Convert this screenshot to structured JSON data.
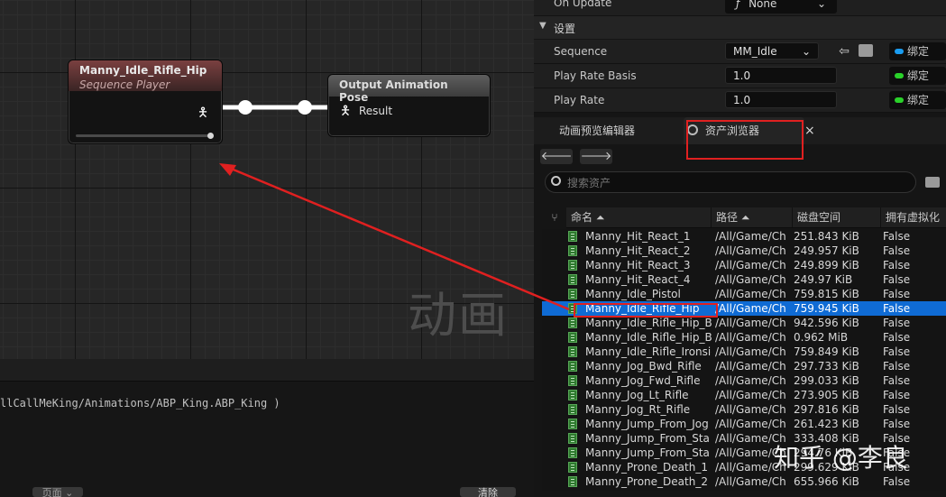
{
  "graph": {
    "node1": {
      "title": "Manny_Idle_Rifle_Hip",
      "subtitle": "Sequence Player"
    },
    "node2": {
      "title": "Output Animation Pose",
      "pin": "Result"
    },
    "watermark": "动画"
  },
  "log": {
    "path_text": "llCallMeKing/Animations/ABP_King.ABP_King )",
    "page_btn": "页面 ⌄",
    "clear_btn": "清除"
  },
  "details": {
    "on_update": {
      "label": "On Update",
      "value": "None",
      "fx": "ƒ"
    },
    "section": "设置",
    "rows": [
      {
        "label": "Sequence",
        "value": "MM_Idle",
        "bind": "绑定",
        "dot_color": "#1a9cf0"
      },
      {
        "label": "Play Rate Basis",
        "value": "1.0",
        "bind": "绑定",
        "dot_color": "#2ad22a"
      },
      {
        "label": "Play Rate",
        "value": "1.0",
        "bind": "绑定",
        "dot_color": "#2ad22a"
      }
    ]
  },
  "tabs": {
    "anim_preview": "动画预览编辑器",
    "asset_browser": "资产浏览器",
    "close": "×"
  },
  "asset_browser": {
    "search_placeholder": "搜索资产",
    "columns": [
      "命名 ⏶",
      "路径 ⏶",
      "磁盘空间",
      "拥有虚拟化"
    ],
    "rows": [
      {
        "name": "Manny_Hit_React_1",
        "path": "/All/Game/Ch",
        "size": "251.843 KiB",
        "virt": "False"
      },
      {
        "name": "Manny_Hit_React_2",
        "path": "/All/Game/Ch",
        "size": "249.957 KiB",
        "virt": "False"
      },
      {
        "name": "Manny_Hit_React_3",
        "path": "/All/Game/Ch",
        "size": "249.899 KiB",
        "virt": "False"
      },
      {
        "name": "Manny_Hit_React_4",
        "path": "/All/Game/Ch",
        "size": "249.97 KiB",
        "virt": "False"
      },
      {
        "name": "Manny_Idle_Pistol",
        "path": "/All/Game/Ch",
        "size": "759.815 KiB",
        "virt": "False"
      },
      {
        "name": "Manny_Idle_Rifle_Hip",
        "path": "/All/Game/Ch",
        "size": "759.945 KiB",
        "virt": "False"
      },
      {
        "name": "Manny_Idle_Rifle_Hip_Br",
        "path": "/All/Game/Ch",
        "size": "942.596 KiB",
        "virt": "False"
      },
      {
        "name": "Manny_Idle_Rifle_Hip_Br",
        "path": "/All/Game/Ch",
        "size": "0.962 MiB",
        "virt": "False"
      },
      {
        "name": "Manny_Idle_Rifle_Ironsic",
        "path": "/All/Game/Ch",
        "size": "759.849 KiB",
        "virt": "False"
      },
      {
        "name": "Manny_Jog_Bwd_Rifle",
        "path": "/All/Game/Ch",
        "size": "297.733 KiB",
        "virt": "False"
      },
      {
        "name": "Manny_Jog_Fwd_Rifle",
        "path": "/All/Game/Ch",
        "size": "299.033 KiB",
        "virt": "False"
      },
      {
        "name": "Manny_Jog_Lt_Rifle",
        "path": "/All/Game/Ch",
        "size": "273.905 KiB",
        "virt": "False"
      },
      {
        "name": "Manny_Jog_Rt_Rifle",
        "path": "/All/Game/Ch",
        "size": "297.816 KiB",
        "virt": "False"
      },
      {
        "name": "Manny_Jump_From_Jog",
        "path": "/All/Game/Ch",
        "size": "261.423 KiB",
        "virt": "False"
      },
      {
        "name": "Manny_Jump_From_Sta",
        "path": "/All/Game/Ch",
        "size": "333.408 KiB",
        "virt": "False"
      },
      {
        "name": "Manny_Jump_From_Sta",
        "path": "/All/Game/Ch",
        "size": "294.76 KiB",
        "virt": "False"
      },
      {
        "name": "Manny_Prone_Death_1",
        "path": "/All/Game/Ch",
        "size": "299.629 KiB",
        "virt": "False"
      },
      {
        "name": "Manny_Prone_Death_2",
        "path": "/All/Game/Ch",
        "size": "655.966 KiB",
        "virt": "False"
      }
    ],
    "selected_index": 5
  },
  "overlay_watermark": "知乎 @李良",
  "colors": {
    "selection": "#0f6bd4",
    "annotation": "#e02020",
    "node1_header": "#6e3a3a",
    "node2_header": "#555555"
  }
}
